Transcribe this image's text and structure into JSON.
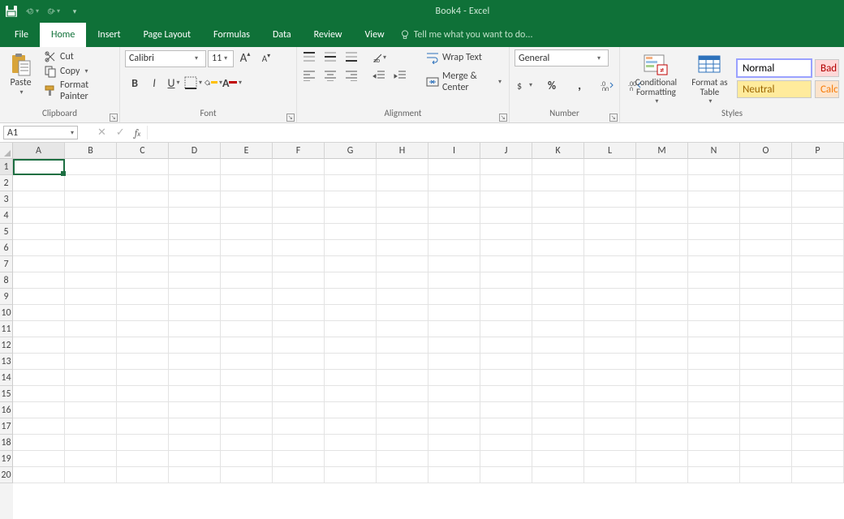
{
  "title": "Book4 - Excel",
  "qat": {
    "save": "save",
    "undo": "undo",
    "redo": "redo"
  },
  "tabs": {
    "file": "File",
    "home": "Home",
    "insert": "Insert",
    "page_layout": "Page Layout",
    "formulas": "Formulas",
    "data": "Data",
    "review": "Review",
    "view": "View"
  },
  "tell_me_placeholder": "Tell me what you want to do...",
  "ribbon": {
    "clipboard": {
      "label": "Clipboard",
      "paste": "Paste",
      "cut": "Cut",
      "copy": "Copy",
      "format_painter": "Format Painter"
    },
    "font": {
      "label": "Font",
      "name": "Calibri",
      "size": "11",
      "increase": "A",
      "decrease": "A",
      "bold": "B",
      "italic": "I",
      "underline": "U"
    },
    "alignment": {
      "label": "Alignment",
      "wrap": "Wrap Text",
      "merge": "Merge & Center"
    },
    "number": {
      "label": "Number",
      "format": "General",
      "currency": "$",
      "percent": "%",
      "comma": ",",
      "inc_dec": "Increase Decimal",
      "dec_dec": "Decrease Decimal"
    },
    "styles": {
      "label": "Styles",
      "conditional": "Conditional Formatting",
      "format_table": "Format as Table",
      "normal": "Normal",
      "bad": "Bad",
      "neutral": "Neutral",
      "calc": "Calc"
    }
  },
  "name_box": "A1",
  "formula": "",
  "columns": [
    "A",
    "B",
    "C",
    "D",
    "E",
    "F",
    "G",
    "H",
    "I",
    "J",
    "K",
    "L",
    "M",
    "N",
    "O",
    "P"
  ],
  "rows": [
    "1",
    "2",
    "3",
    "4",
    "5",
    "6",
    "7",
    "8",
    "9",
    "10",
    "11",
    "12",
    "13",
    "14",
    "15",
    "16",
    "17",
    "18",
    "19",
    "20"
  ],
  "selected_col": "A",
  "selected_row": "1",
  "colors": {
    "accent": "#0f7138",
    "fill_swatch": "#ffc000",
    "font_swatch": "#c00000"
  }
}
